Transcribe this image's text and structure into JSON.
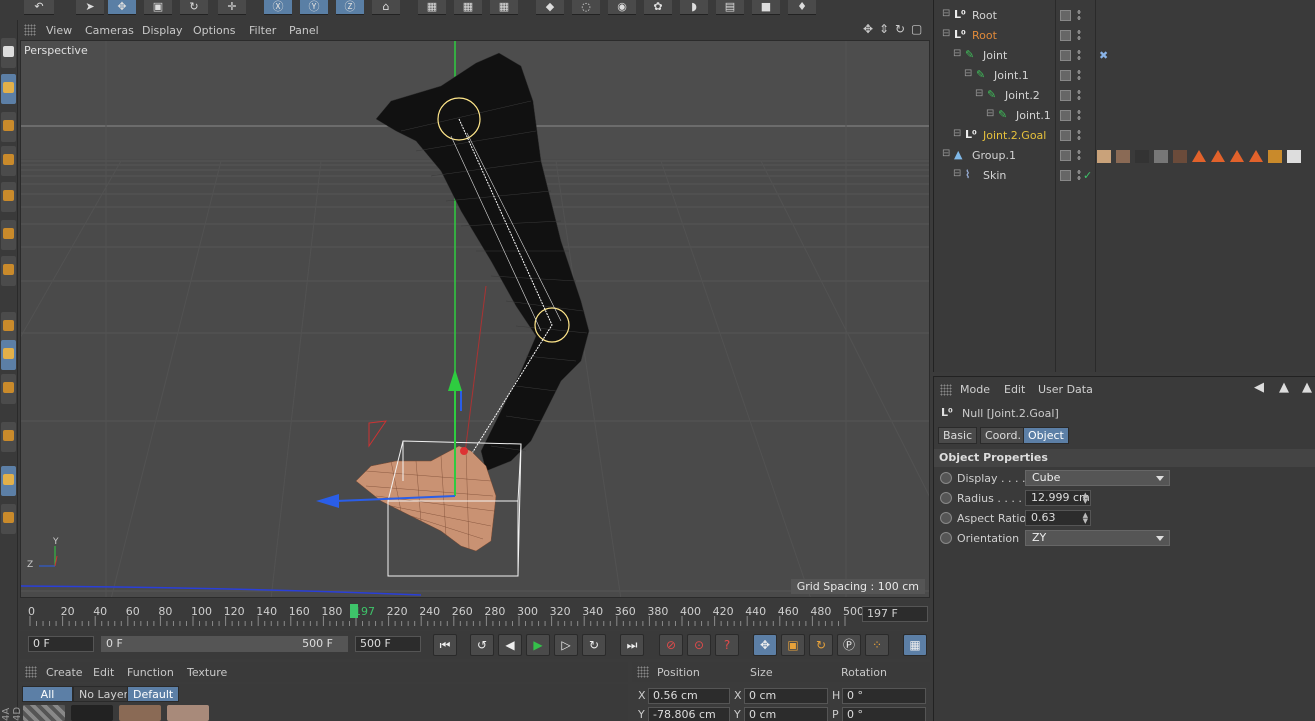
{
  "viewport": {
    "menu": [
      "View",
      "Cameras",
      "Display",
      "Options",
      "Filter",
      "Panel"
    ],
    "camera_label": "Perspective",
    "grid_spacing": "Grid Spacing : 100 cm",
    "axis_labels": {
      "y": "Y",
      "z": "Z"
    }
  },
  "timeline": {
    "ticks": [
      "0",
      "20",
      "40",
      "60",
      "80",
      "100",
      "120",
      "140",
      "160",
      "180",
      "197",
      "220",
      "240",
      "260",
      "280",
      "300",
      "320",
      "340",
      "360",
      "380",
      "400",
      "420",
      "440",
      "460",
      "480",
      "500"
    ],
    "current_frame": "197",
    "current_frame_field": "197 F"
  },
  "playback": {
    "start_field": "0 F",
    "range_start": "0 F",
    "range_end": "500 F",
    "end_field": "500 F",
    "buttons": [
      "go-to-start",
      "previous-key",
      "previous-frame",
      "play",
      "next-frame",
      "next-key",
      "go-to-end",
      "record-active",
      "autokey",
      "keyframe-selection",
      "move-key",
      "scale-key",
      "rotate-key",
      "param-key",
      "point-level",
      "timeline-layout"
    ]
  },
  "material_manager": {
    "menu": [
      "Create",
      "Edit",
      "Function",
      "Texture"
    ],
    "tabs": [
      "All",
      "No Layer",
      "Default"
    ],
    "active_tab": "All"
  },
  "coordinates": {
    "headers": [
      "Position",
      "Size",
      "Rotation"
    ],
    "rows": [
      {
        "pos_axis": "X",
        "pos": "0.56 cm",
        "size_axis": "X",
        "size": "0 cm",
        "rot_axis": "H",
        "rot": "0 °"
      },
      {
        "pos_axis": "Y",
        "pos": "-78.806 cm",
        "size_axis": "Y",
        "size": "0 cm",
        "rot_axis": "P",
        "rot": "0 °"
      }
    ]
  },
  "object_manager": {
    "objects": [
      {
        "name": "Root",
        "color": "normal",
        "indent": 0,
        "icon": "null-icon"
      },
      {
        "name": "Root",
        "color": "orange",
        "indent": 0,
        "icon": "null-icon"
      },
      {
        "name": "Joint",
        "color": "normal",
        "indent": 1,
        "icon": "joint-icon"
      },
      {
        "name": "Joint.1",
        "color": "normal",
        "indent": 2,
        "icon": "joint-icon"
      },
      {
        "name": "Joint.2",
        "color": "normal",
        "indent": 3,
        "icon": "joint-icon"
      },
      {
        "name": "Joint.1",
        "color": "normal",
        "indent": 4,
        "icon": "joint-icon"
      },
      {
        "name": "Joint.2.Goal",
        "color": "yellow",
        "indent": 1,
        "icon": "null-icon"
      },
      {
        "name": "Group.1",
        "color": "normal",
        "indent": 0,
        "icon": "group-icon"
      },
      {
        "name": "Skin",
        "color": "normal",
        "indent": 1,
        "icon": "skin-icon"
      }
    ]
  },
  "attributes": {
    "menu": [
      "Mode",
      "Edit",
      "User Data"
    ],
    "title": "Null [Joint.2.Goal]",
    "tabs": [
      "Basic",
      "Coord.",
      "Object"
    ],
    "active_tab": "Object",
    "section": "Object Properties",
    "fields": [
      {
        "label": "Display . . . .",
        "value": "Cube",
        "type": "dropdown"
      },
      {
        "label": "Radius . . . . .",
        "value": "12.999 cm",
        "type": "number"
      },
      {
        "label": "Aspect Ratio",
        "value": "0.63",
        "type": "number"
      },
      {
        "label": "Orientation",
        "value": "ZY",
        "type": "dropdown"
      }
    ]
  },
  "brand": "4A 4D",
  "colors": {
    "accent": "#5c7fa6",
    "orange": "#e08a3a",
    "yellow": "#e6c13c",
    "y_axis": "#2ecc40",
    "z_axis": "#2a5ee8",
    "x_axis": "#d23a3a",
    "playhead": "#3ec46a"
  }
}
